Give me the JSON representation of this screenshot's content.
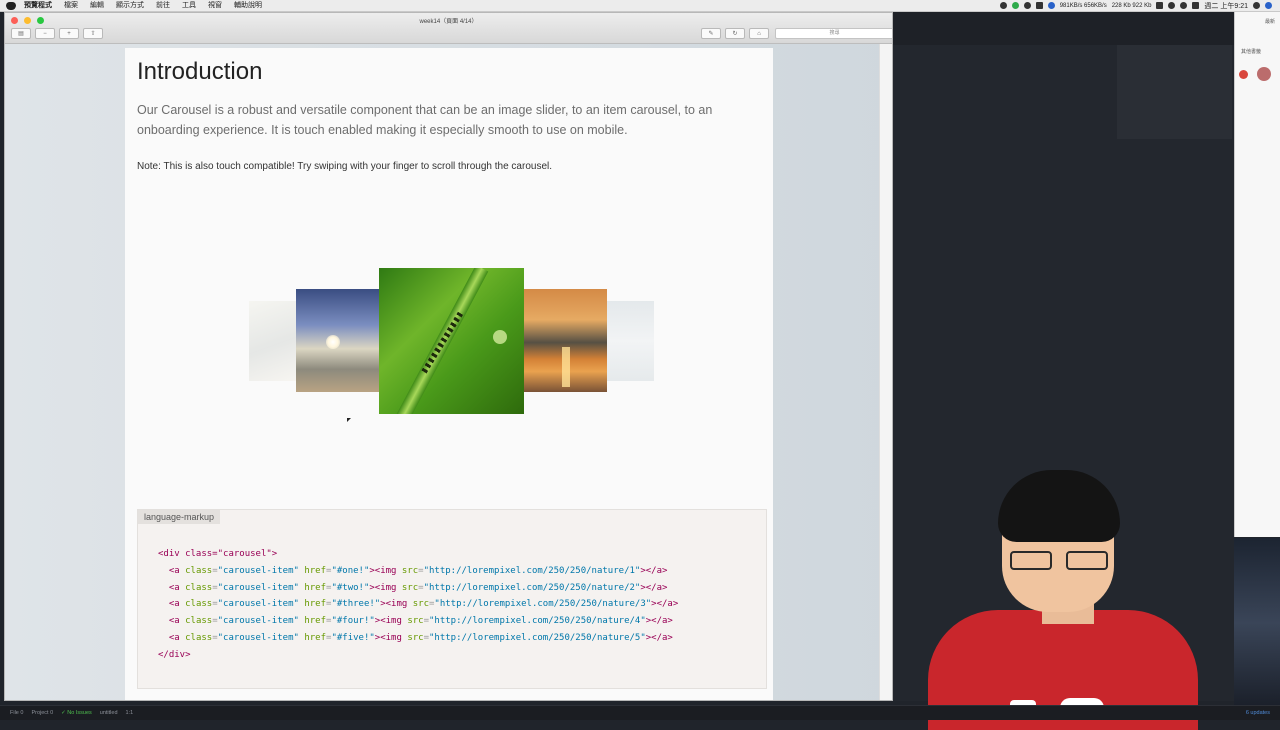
{
  "menubar": {
    "items": [
      "預覽程式",
      "檔案",
      "編輯",
      "顯示方式",
      "前往",
      "工具",
      "視窗",
      "輔助說明"
    ],
    "status_text": [
      "981KB/s 656KB/s",
      "228 Kb 922 Kb"
    ],
    "clock": "週二 上午9:21"
  },
  "window": {
    "title": "week14（頁面 4/14）",
    "search_placeholder": "搜尋"
  },
  "page": {
    "heading": "Introduction",
    "lead": "Our Carousel is a robust and versatile component that can be an image slider, to an item carousel, to an onboarding experience. It is touch enabled making it especially smooth to use on mobile.",
    "note": "Note: This is also touch compatible! Try swiping with your finger to scroll through the carousel."
  },
  "carousel": {
    "items": [
      "nature 1",
      "nature 2",
      "nature 3",
      "nature 4",
      "nature 5"
    ]
  },
  "code": {
    "language": "language-markup",
    "open": "<div class=\"carousel\">",
    "close": "</div>",
    "lines": [
      {
        "href": "#one!",
        "src": "http://lorempixel.com/250/250/nature/1"
      },
      {
        "href": "#two!",
        "src": "http://lorempixel.com/250/250/nature/2"
      },
      {
        "href": "#three!",
        "src": "http://lorempixel.com/250/250/nature/3"
      },
      {
        "href": "#four!",
        "src": "http://lorempixel.com/250/250/nature/4"
      },
      {
        "href": "#five!",
        "src": "http://lorempixel.com/250/250/nature/5"
      }
    ]
  },
  "right_panel": {
    "top_label": "最新",
    "section_label": "其他書籤"
  },
  "bottombar": {
    "file": "File 0",
    "project": "Project 0",
    "issues": "✓ No Issues",
    "untitled": "untitled",
    "position": "1:1",
    "updates": "6 updates"
  },
  "colors": {
    "code_tag": "#990055",
    "code_attr": "#669900",
    "code_value": "#0077aa",
    "accent_red": "#c9262c"
  }
}
